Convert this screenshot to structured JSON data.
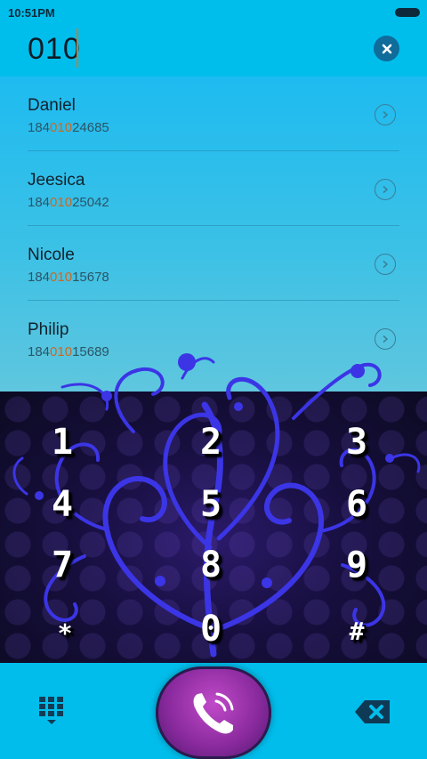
{
  "status": {
    "time": "10:51PM"
  },
  "dial": {
    "input": "010"
  },
  "results": [
    {
      "name": "Daniel",
      "pre": "184",
      "match": "010",
      "post": "24685"
    },
    {
      "name": "Jeesica",
      "pre": "184",
      "match": "010",
      "post": "25042"
    },
    {
      "name": "Nicole",
      "pre": "184",
      "match": "010",
      "post": "15678"
    },
    {
      "name": "Philip",
      "pre": "184",
      "match": "010",
      "post": "15689"
    }
  ],
  "keys": [
    "1",
    "2",
    "3",
    "4",
    "5",
    "6",
    "7",
    "8",
    "9",
    "*",
    "0",
    "#"
  ],
  "icons": {
    "clear": "close-circle-icon",
    "row_arrow": "chevron-right-circle-icon",
    "keyboard": "dialpad-icon",
    "call": "phone-icon",
    "delete": "backspace-icon",
    "battery": "battery-icon"
  },
  "colors": {
    "background": "#00BDEB",
    "match": "#D0671F",
    "call_button": "#A33AB8"
  }
}
